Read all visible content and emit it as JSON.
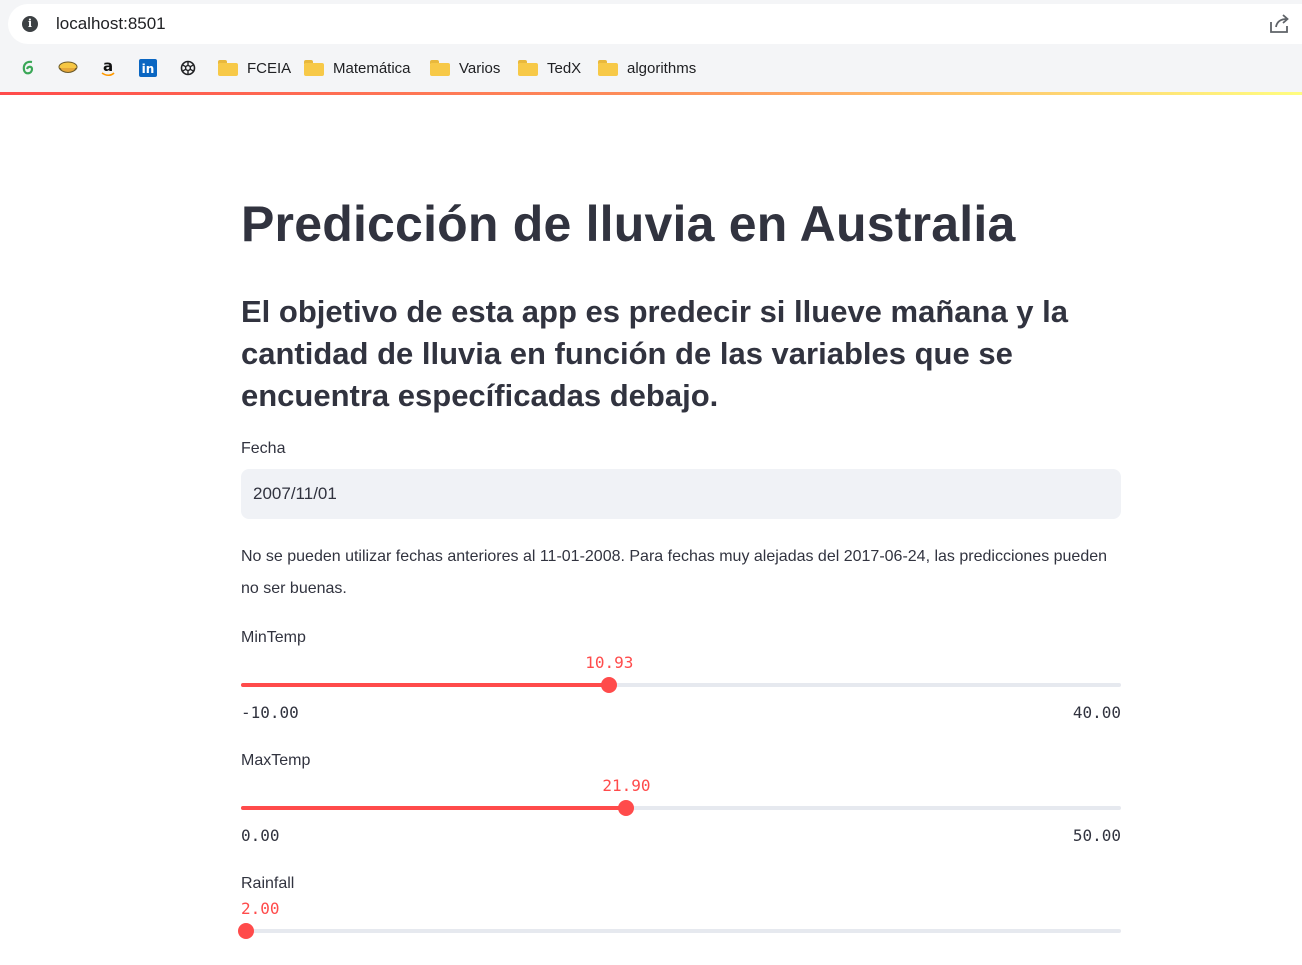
{
  "browser": {
    "url": "localhost:8501",
    "bookmarks": [
      {
        "icon": "green-swirl-icon",
        "label": ""
      },
      {
        "icon": "bowl-icon",
        "label": ""
      },
      {
        "icon": "amazon-icon",
        "label": "a"
      },
      {
        "icon": "linkedin-icon",
        "label": "in"
      },
      {
        "icon": "openai-icon",
        "label": ""
      },
      {
        "icon": "folder-icon",
        "label": "FCEIA"
      },
      {
        "icon": "folder-icon",
        "label": "Matemática"
      },
      {
        "icon": "folder-icon",
        "label": "Varios"
      },
      {
        "icon": "folder-icon",
        "label": "TedX"
      },
      {
        "icon": "folder-icon",
        "label": "algorithms"
      }
    ]
  },
  "colors": {
    "accent": "#ff4b4b",
    "text": "#31333f",
    "input_bg": "#f0f2f6",
    "track": "#e6e9ef"
  },
  "page": {
    "title": "Predicción de lluvia en Australia",
    "subtitle": "El objetivo de esta app es predecir si llueve mañana y la cantidad de lluvia en función de las variables que se encuentra especíﬁcadas debajo.",
    "date_label": "Fecha",
    "date_value": "2007/11/01",
    "date_note": "No se pueden utilizar fechas anteriores al 11-01-2008. Para fechas muy alejadas del 2017-06-24, las predicciones pueden no ser buenas."
  },
  "sliders": [
    {
      "label": "MinTemp",
      "value": 10.93,
      "value_text": "10.93",
      "min": -10,
      "max": 40,
      "min_text": "-10.00",
      "max_text": "40.00"
    },
    {
      "label": "MaxTemp",
      "value": 21.9,
      "value_text": "21.90",
      "min": 0,
      "max": 50,
      "min_text": "0.00",
      "max_text": "50.00"
    },
    {
      "label": "Rainfall",
      "value": 2.0,
      "value_text": "2.00",
      "min": 0,
      "max": 371,
      "min_text": "",
      "max_text": ""
    }
  ]
}
